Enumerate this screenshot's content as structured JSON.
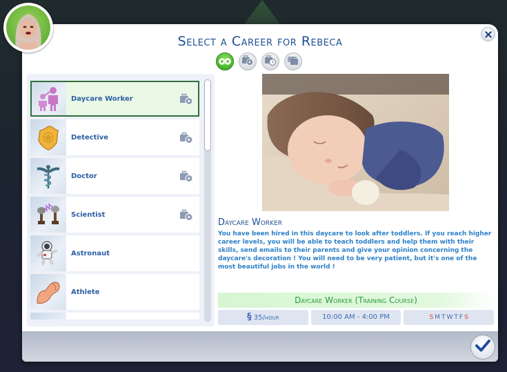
{
  "dialog": {
    "title": "Select a Career for Rebeca",
    "sim_name": "Rebeca"
  },
  "filters": [
    {
      "name": "all-careers",
      "icon": "infinity-icon",
      "active": true
    },
    {
      "name": "part-time",
      "icon": "briefcase-play-icon",
      "active": false
    },
    {
      "name": "scheduled",
      "icon": "briefcase-clock-icon",
      "active": false
    },
    {
      "name": "full-time",
      "icon": "briefcase-stack-icon",
      "active": false
    }
  ],
  "careers": [
    {
      "name": "Daycare Worker",
      "icon": "daycare-icon",
      "badge": "briefcase-play-icon",
      "selected": true
    },
    {
      "name": "Detective",
      "icon": "badge-icon",
      "badge": "briefcase-play-icon",
      "selected": false
    },
    {
      "name": "Doctor",
      "icon": "caduceus-icon",
      "badge": "briefcase-play-icon",
      "selected": false
    },
    {
      "name": "Scientist",
      "icon": "tesla-coil-icon",
      "badge": "briefcase-play-icon",
      "selected": false
    },
    {
      "name": "Astronaut",
      "icon": "astronaut-icon",
      "badge": null,
      "selected": false
    },
    {
      "name": "Athlete",
      "icon": "muscle-arm-icon",
      "badge": null,
      "selected": false
    },
    {
      "name": "",
      "icon": "partial-career-icon",
      "badge": null,
      "selected": false
    }
  ],
  "detail": {
    "title": "Daycare Worker",
    "description": "You have been hired in this daycare to look after toddlers. If you reach higher career levels, you will be able to teach toddlers and help them with their skills, send emails to their parents and give your opinion concerning the daycare's decoration ! You will need to be very patient, but it's one of the most beautiful jobs in the world !",
    "image": "sleeping-toddler-photo",
    "course": "Daycare Worker (Training Course)",
    "pay_symbol": "§",
    "pay": "35/hour",
    "hours": "10:00  AM - 4:00  PM",
    "days": [
      {
        "label": "S",
        "works": false
      },
      {
        "label": "M",
        "works": true
      },
      {
        "label": "T",
        "works": true
      },
      {
        "label": "W",
        "works": true
      },
      {
        "label": "T",
        "works": true
      },
      {
        "label": "F",
        "works": true
      },
      {
        "label": "S",
        "works": false
      }
    ]
  },
  "colors": {
    "title": "#1f4f93",
    "career_name": "#2e5ea3",
    "description": "#2c80c8",
    "course": "#2a9a3c",
    "weekend": "#d23b3b",
    "selected_border": "#2f6f3a",
    "active_filter": "#45b52c"
  },
  "buttons": {
    "close": "close-icon",
    "confirm": "checkmark-icon"
  }
}
